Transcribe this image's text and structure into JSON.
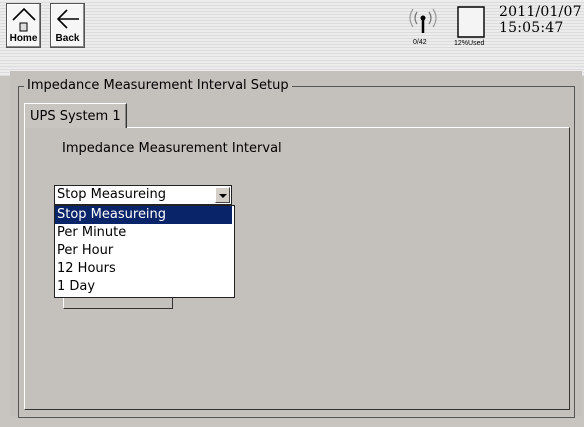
{
  "nav": {
    "home_label": "Home",
    "back_label": "Back"
  },
  "status": {
    "signal_count": "0/42",
    "storage_used": "12%Used",
    "date": "2011/01/07",
    "time": "15:05:47"
  },
  "group": {
    "title": "Impedance Measurement Interval Setup"
  },
  "tabs": [
    {
      "label": "UPS System 1"
    }
  ],
  "field": {
    "label": "Impedance Measurement Interval",
    "selected": "Stop Measureing",
    "options": [
      "Stop Measureing",
      "Per Minute",
      "Per Hour",
      "12 Hours",
      "1 Day"
    ]
  },
  "colors": {
    "selection": "#0a246a",
    "panel": "#c4c0bc"
  },
  "icons": {
    "home": "home-icon",
    "back": "back-arrow-icon",
    "signal": "signal-icon",
    "storage": "sd-card-icon"
  }
}
